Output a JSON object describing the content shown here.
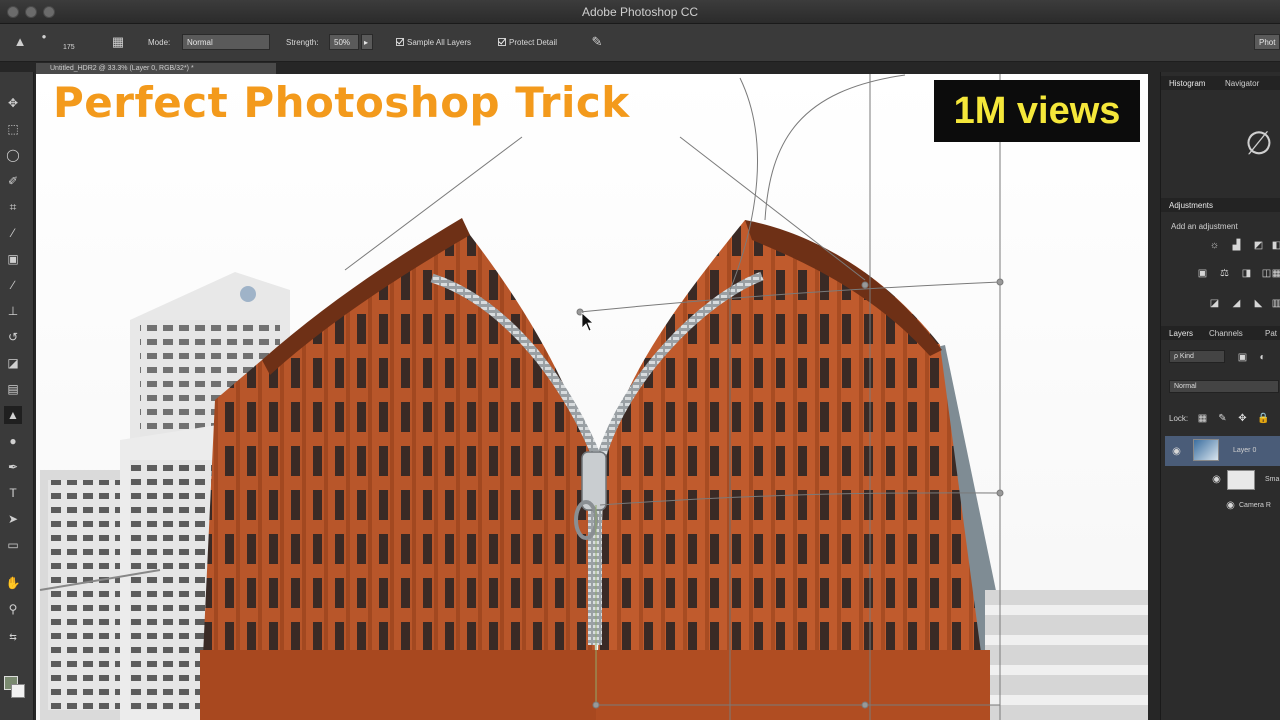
{
  "window": {
    "title": "Adobe Photoshop CC"
  },
  "options_bar": {
    "brush_size": "175",
    "mode_label": "Mode:",
    "mode_value": "Normal",
    "strength_label": "Strength:",
    "strength_value": "50%",
    "sample_all_layers": "Sample All Layers",
    "protect_detail": "Protect Detail",
    "workspace": "Phot"
  },
  "document_tab": {
    "title": "Untitled_HDR2 @ 33.3% (Layer 0, RGB/32*) *"
  },
  "overlay": {
    "headline": "Perfect Photoshop Trick",
    "badge": "1M views"
  },
  "panels": {
    "histogram_tab": "Histogram",
    "navigator_tab": "Navigator",
    "adjustments_tab": "Adjustments",
    "add_adjustment": "Add an adjustment",
    "layers_tab": "Layers",
    "channels_tab": "Channels",
    "paths_tab": "Pat",
    "kind_filter": "ρ Kind",
    "blend_mode": "Normal",
    "lock_label": "Lock:",
    "layer_name": "Layer 0",
    "smart_filters": "Sma",
    "camera_raw": "Camera R"
  },
  "colors": {
    "headline": "#f39a1c",
    "badge_text": "#f5e73a",
    "badge_bg": "#0c0c0c",
    "brick": "#b8562a"
  }
}
